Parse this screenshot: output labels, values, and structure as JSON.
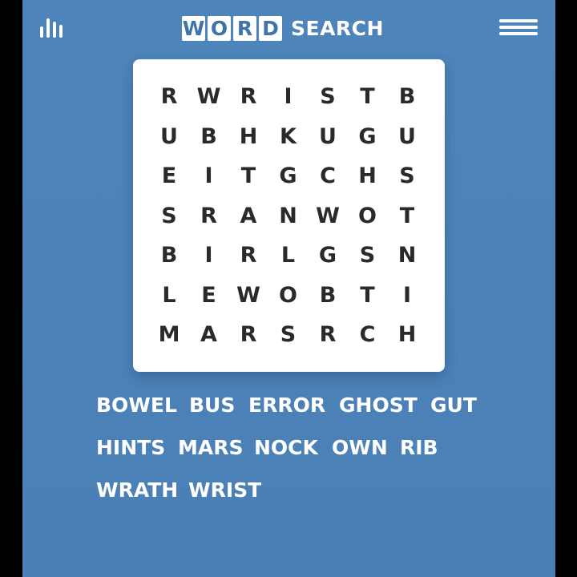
{
  "header": {
    "logo_tiles": [
      "W",
      "O",
      "R",
      "D"
    ],
    "logo_rest": "SEARCH",
    "left_icon": "stats-bars-icon",
    "right_icon": "hamburger-menu-icon"
  },
  "grid": {
    "rows": [
      [
        "R",
        "W",
        "R",
        "I",
        "S",
        "T",
        "B"
      ],
      [
        "U",
        "B",
        "H",
        "K",
        "U",
        "G",
        "U"
      ],
      [
        "E",
        "I",
        "T",
        "G",
        "C",
        "H",
        "S"
      ],
      [
        "S",
        "R",
        "A",
        "N",
        "W",
        "O",
        "T"
      ],
      [
        "B",
        "I",
        "R",
        "L",
        "G",
        "S",
        "N"
      ],
      [
        "L",
        "E",
        "W",
        "O",
        "B",
        "T",
        "I"
      ],
      [
        "M",
        "A",
        "R",
        "S",
        "R",
        "C",
        "H"
      ]
    ]
  },
  "word_list": [
    "BOWEL",
    "BUS",
    "ERROR",
    "GHOST",
    "GUT",
    "HINTS",
    "MARS",
    "NOCK",
    "OWN",
    "RIB",
    "WRATH",
    "WRIST"
  ],
  "colors": {
    "background": "#4a80b6",
    "tile_text": "#3f74a8",
    "grid_letter": "#2a2a2a"
  }
}
